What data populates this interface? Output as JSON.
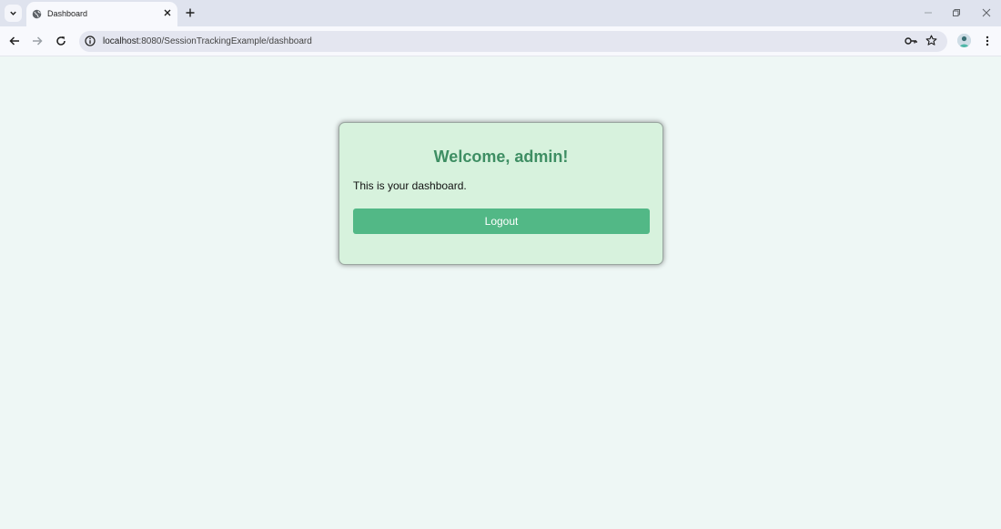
{
  "browser": {
    "tab": {
      "title": "Dashboard"
    },
    "address_bar": {
      "host": "localhost",
      "rest": ":8080/SessionTrackingExample/dashboard"
    }
  },
  "page": {
    "welcome_heading": "Welcome, admin!",
    "description": "This is your dashboard.",
    "logout_label": "Logout"
  },
  "colors": {
    "page_background": "#eef7f5",
    "card_background": "#d7f2dd",
    "heading_color": "#3e8e63",
    "button_color": "#52b886"
  }
}
